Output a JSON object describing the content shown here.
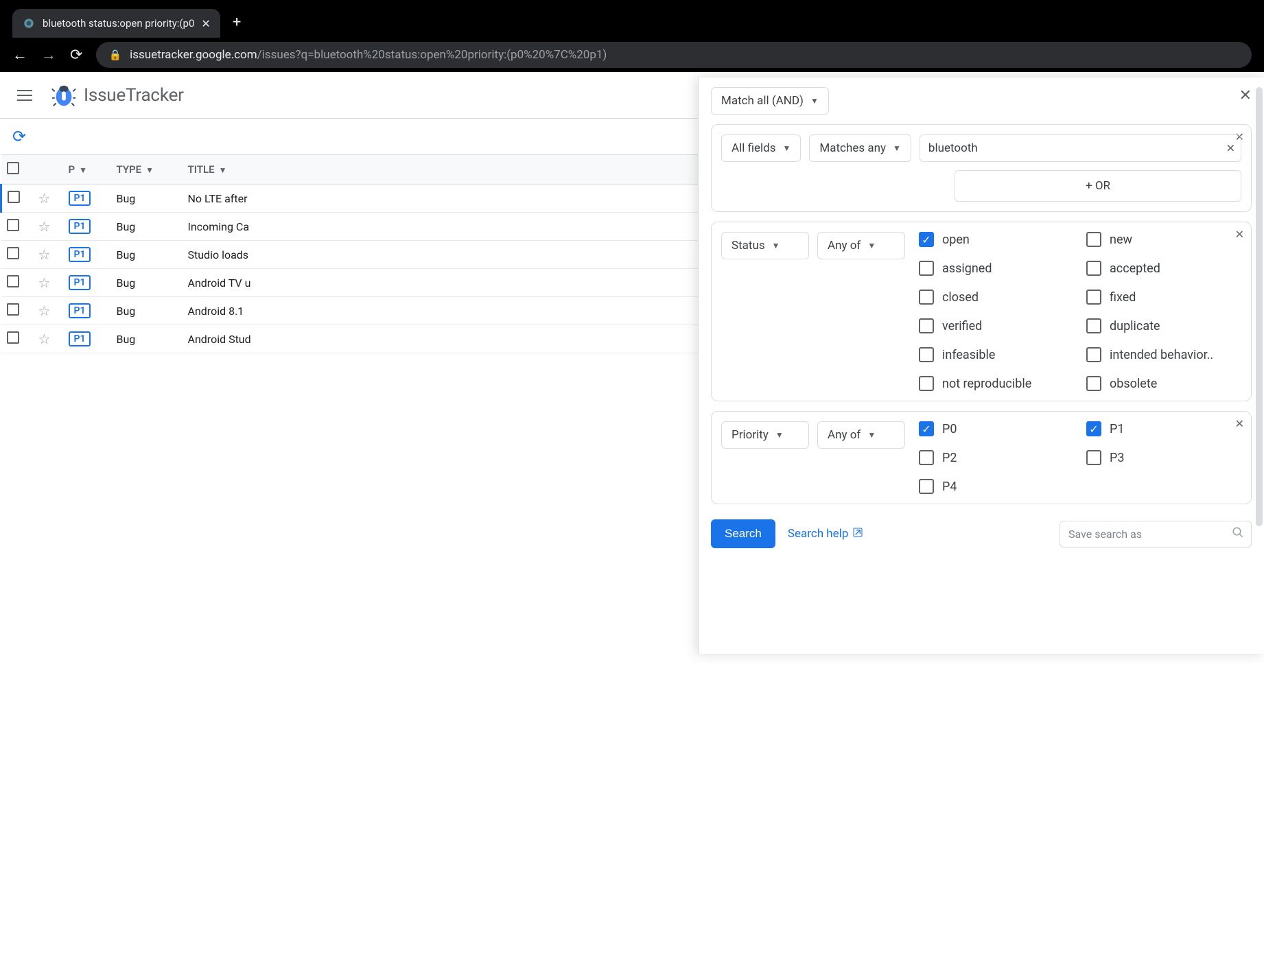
{
  "browser": {
    "tab_title": "bluetooth status:open priority:(p0",
    "url_host": "issuetracker.google.com",
    "url_path": "/issues?q=bluetooth%20status:open%20priority:(p0%20%7C%20p1)"
  },
  "app": {
    "title": "IssueTracker"
  },
  "table": {
    "headers": {
      "priority": "P",
      "type": "TYPE",
      "title": "TITLE"
    },
    "rows": [
      {
        "priority": "P1",
        "type": "Bug",
        "title": "No LTE after"
      },
      {
        "priority": "P1",
        "type": "Bug",
        "title": "Incoming Ca"
      },
      {
        "priority": "P1",
        "type": "Bug",
        "title": "Studio loads"
      },
      {
        "priority": "P1",
        "type": "Bug",
        "title": "Android TV u"
      },
      {
        "priority": "P1",
        "type": "Bug",
        "title": "Android 8.1 "
      },
      {
        "priority": "P1",
        "type": "Bug",
        "title": "Android Stud"
      }
    ]
  },
  "panel": {
    "match_mode": "Match all (AND)",
    "block1": {
      "field": "All fields",
      "op": "Matches any",
      "value": "bluetooth",
      "or_label": "+ OR"
    },
    "block2": {
      "field": "Status",
      "op": "Any of",
      "options": [
        {
          "label": "open",
          "checked": true
        },
        {
          "label": "new",
          "checked": false
        },
        {
          "label": "assigned",
          "checked": false
        },
        {
          "label": "accepted",
          "checked": false
        },
        {
          "label": "closed",
          "checked": false
        },
        {
          "label": "fixed",
          "checked": false
        },
        {
          "label": "verified",
          "checked": false
        },
        {
          "label": "duplicate",
          "checked": false
        },
        {
          "label": "infeasible",
          "checked": false
        },
        {
          "label": "intended behavior..",
          "checked": false
        },
        {
          "label": "not reproducible",
          "checked": false
        },
        {
          "label": "obsolete",
          "checked": false
        }
      ]
    },
    "block3": {
      "field": "Priority",
      "op": "Any of",
      "options": [
        {
          "label": "P0",
          "checked": true
        },
        {
          "label": "P1",
          "checked": true
        },
        {
          "label": "P2",
          "checked": false
        },
        {
          "label": "P3",
          "checked": false
        },
        {
          "label": "P4",
          "checked": false
        }
      ]
    },
    "search_btn": "Search",
    "help_link": "Search help",
    "save_placeholder": "Save search as"
  }
}
